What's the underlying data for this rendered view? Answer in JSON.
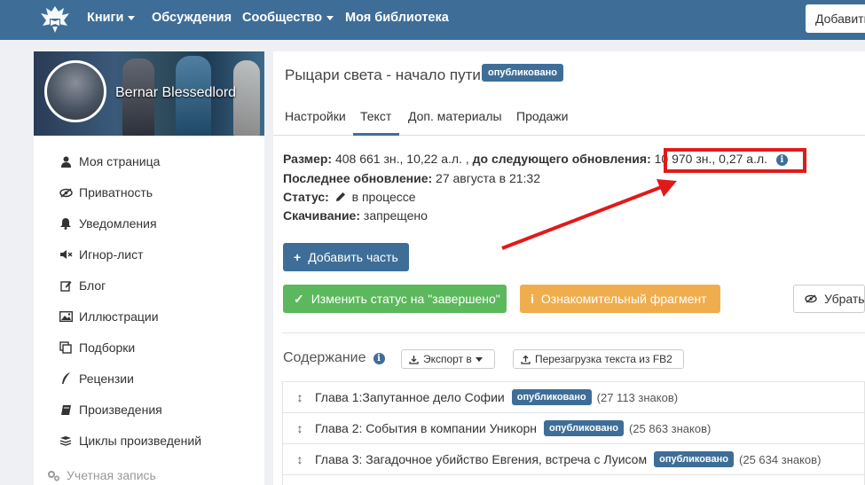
{
  "colors": {
    "topbar": "#3e6e98",
    "accent": "#3e6e98",
    "green": "#5cb85c",
    "orange": "#f0ad4e",
    "highlight": "#e01a1a"
  },
  "nav": {
    "items": [
      {
        "label": "Книги",
        "dropdown": true
      },
      {
        "label": "Обсуждения",
        "dropdown": false
      },
      {
        "label": "Сообщество",
        "dropdown": true
      },
      {
        "label": "Моя библиотека",
        "dropdown": false
      }
    ],
    "add_button": "Добавить"
  },
  "profile": {
    "name": "Bernar Blessedlord"
  },
  "sidebar": {
    "items": [
      {
        "label": "Моя страница",
        "icon": "user-icon"
      },
      {
        "label": "Приватность",
        "icon": "eye-slash-icon"
      },
      {
        "label": "Уведомления",
        "icon": "bell-icon"
      },
      {
        "label": "Игнор-лист",
        "icon": "volume-off-icon"
      },
      {
        "label": "Блог",
        "icon": "edit-icon"
      },
      {
        "label": "Иллюстрации",
        "icon": "image-icon"
      },
      {
        "label": "Подборки",
        "icon": "collection-icon"
      },
      {
        "label": "Рецензии",
        "icon": "quill-icon"
      },
      {
        "label": "Произведения",
        "icon": "book-icon"
      },
      {
        "label": "Циклы произведений",
        "icon": "stack-icon"
      }
    ],
    "account_label": "Учетная запись"
  },
  "book": {
    "title": "Рыцари света - начало пути",
    "status_badge": "опубликовано"
  },
  "tabs": [
    {
      "label": "Настройки",
      "active": false
    },
    {
      "label": "Текст",
      "active": true
    },
    {
      "label": "Доп. материалы",
      "active": false
    },
    {
      "label": "Продажи",
      "active": false
    }
  ],
  "info": {
    "size_label": "Размер:",
    "size_value": "408 661 зн., 10,22 а.л. ,",
    "next_label": "до следующего обновления:",
    "next_value": "10 970 зн., 0,27 а.л.",
    "updated_label": "Последнее обновление:",
    "updated_value": "27 августа в 21:32",
    "status_label": "Статус:",
    "status_value": "в процессе",
    "download_label": "Скачивание:",
    "download_value": "запрещено"
  },
  "buttons": {
    "add_part": "Добавить часть",
    "change_status": "Изменить статус на \"завершено\"",
    "fragment": "Ознакомительный фрагмент",
    "hide": "Убрать"
  },
  "toc": {
    "title": "Содержание",
    "export": "Экспорт в",
    "reupload": "Перезагрузка текста из FB2",
    "chapters": [
      {
        "title": "Глава 1:Запутанное дело Софии",
        "badge": "опубликовано",
        "count": "(27 113 знаков)"
      },
      {
        "title": "Глава 2: События в компании Уникорн",
        "badge": "опубликовано",
        "count": "(25 863 знаков)"
      },
      {
        "title": "Глава 3: Загадочное убийство Евгения, встреча с Луисом",
        "badge": "опубликовано",
        "count": "(25 634 знаков)"
      }
    ]
  }
}
